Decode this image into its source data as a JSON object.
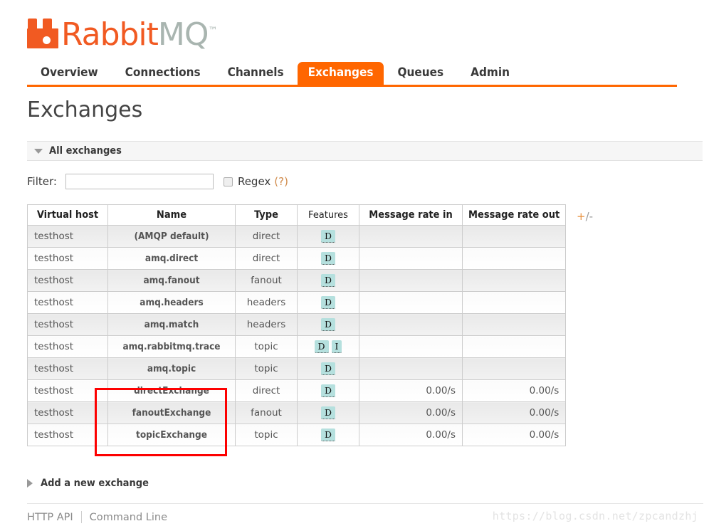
{
  "brand": {
    "name_part1": "Rabbit",
    "name_part2": "MQ",
    "trademark": "™",
    "logo_color": "#f15a22",
    "mq_color": "#a9b5b0"
  },
  "nav": {
    "accent_color": "#ff6600",
    "items": [
      {
        "label": "Overview",
        "active": false
      },
      {
        "label": "Connections",
        "active": false
      },
      {
        "label": "Channels",
        "active": false
      },
      {
        "label": "Exchanges",
        "active": true
      },
      {
        "label": "Queues",
        "active": false
      },
      {
        "label": "Admin",
        "active": false
      }
    ]
  },
  "page": {
    "title": "Exchanges"
  },
  "section": {
    "header_label": "All exchanges",
    "toggle_icon": "triangle-down-icon"
  },
  "filter": {
    "label": "Filter:",
    "value": "",
    "placeholder": "",
    "regex_label": "Regex",
    "regex_help": "(?)",
    "regex_checked": false
  },
  "table": {
    "columns": [
      {
        "label": "Virtual host",
        "align": "left",
        "style": "bold"
      },
      {
        "label": "Name",
        "align": "center",
        "style": "bold"
      },
      {
        "label": "Type",
        "align": "center",
        "style": "bold"
      },
      {
        "label": "Features",
        "align": "center",
        "style": "light"
      },
      {
        "label": "Message rate in",
        "align": "center",
        "style": "bold"
      },
      {
        "label": "Message rate out",
        "align": "center",
        "style": "bold"
      }
    ],
    "column_toggle": {
      "plus": "+",
      "slash": "/",
      "minus": "-"
    },
    "rows": [
      {
        "vhost": "testhost",
        "name": "(AMQP default)",
        "type": "direct",
        "features": [
          "D"
        ],
        "rate_in": "",
        "rate_out": ""
      },
      {
        "vhost": "testhost",
        "name": "amq.direct",
        "type": "direct",
        "features": [
          "D"
        ],
        "rate_in": "",
        "rate_out": ""
      },
      {
        "vhost": "testhost",
        "name": "amq.fanout",
        "type": "fanout",
        "features": [
          "D"
        ],
        "rate_in": "",
        "rate_out": ""
      },
      {
        "vhost": "testhost",
        "name": "amq.headers",
        "type": "headers",
        "features": [
          "D"
        ],
        "rate_in": "",
        "rate_out": ""
      },
      {
        "vhost": "testhost",
        "name": "amq.match",
        "type": "headers",
        "features": [
          "D"
        ],
        "rate_in": "",
        "rate_out": ""
      },
      {
        "vhost": "testhost",
        "name": "amq.rabbitmq.trace",
        "type": "topic",
        "features": [
          "D",
          "I"
        ],
        "rate_in": "",
        "rate_out": ""
      },
      {
        "vhost": "testhost",
        "name": "amq.topic",
        "type": "topic",
        "features": [
          "D"
        ],
        "rate_in": "",
        "rate_out": ""
      },
      {
        "vhost": "testhost",
        "name": "directExchange",
        "type": "direct",
        "features": [
          "D"
        ],
        "rate_in": "0.00/s",
        "rate_out": "0.00/s"
      },
      {
        "vhost": "testhost",
        "name": "fanoutExchange",
        "type": "fanout",
        "features": [
          "D"
        ],
        "rate_in": "0.00/s",
        "rate_out": "0.00/s"
      },
      {
        "vhost": "testhost",
        "name": "topicExchange",
        "type": "topic",
        "features": [
          "D"
        ],
        "rate_in": "0.00/s",
        "rate_out": "0.00/s"
      }
    ]
  },
  "annotation": {
    "color": "#fd0000",
    "highlights": [
      "directExchange",
      "fanoutExchange",
      "topicExchange"
    ]
  },
  "add_exchange": {
    "label": "Add a new exchange",
    "toggle_icon": "triangle-right-icon"
  },
  "footer": {
    "http_api": "HTTP API",
    "command_line": "Command Line"
  },
  "watermark": {
    "text": "https://blog.csdn.net/zpcandzhj"
  }
}
